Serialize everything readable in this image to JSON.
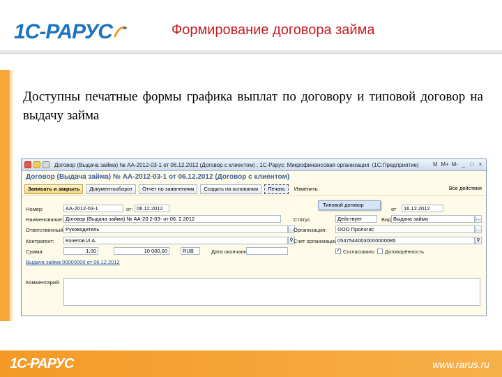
{
  "slide": {
    "logo": "1С-РАРУС",
    "title": "Формирование договора займа",
    "body": "Доступны печатные формы графика выплат по договору и типовой договор на выдачу займа",
    "footer_logo": "1С-РАРУС",
    "footer_url": "www.rarus.ru"
  },
  "window": {
    "title": "Договор (Выдача займа) № АА-2012-03-1 от 06.12.2012 (Договор с клиентом) : 1С-Рарус: Микрофинансовая организация",
    "title_suffix": "(1С:Предприятие)",
    "controls": [
      "M",
      "M+",
      "M-",
      "_",
      "□",
      "×"
    ],
    "doc_header": "Договор (Выдача займа) № АА-2012-03-1 от 06.12.2012 (Договор с клиентом)",
    "toolbar": {
      "save_close": "Записать и закрыть",
      "docflow": "Документооборот",
      "report": "Отчет по заявлениям",
      "create_basis": "Создать на основании",
      "print": "Печать",
      "change": "Изменить",
      "all_actions": "Все действия"
    },
    "dropdown": {
      "item": "Типовой договор"
    },
    "fields": {
      "number_label": "Номер:",
      "number_value": "АА-2012-03-1",
      "from_label": "от:",
      "from_value": "06.12.2012",
      "name_label": "Наименование:",
      "name_value": "Договор (Выдача займа) № АА-20 2-03- от 06. 2.2012",
      "author_label": "Ответственный:",
      "author_value": "Руководитель",
      "contractor_label": "Контрагент:",
      "contractor_value": "Кочетов И.А.",
      "amount_label": "Сумма:",
      "qty_value": "1,00",
      "amount_value": "10 000,00",
      "currency_value": "RUB",
      "due_label": "Дата окончания:",
      "link_text": "Выдача займа 00000000 от 06.12.2012",
      "status_label": "Статус",
      "status_value": "Действует",
      "kind_label": "Вид:",
      "kind_value": "Выдача займа",
      "date_from_label": "от",
      "date_from_value": "16.12.2012",
      "org_label": "Организация:",
      "org_value": "ООО Прологис",
      "org_rep_label": "Счет организации:",
      "org_rep_value": "05475440030000000085",
      "agreed_label": "Согласовано",
      "contracted_label": "Договорённость",
      "comment_label": "Комментарий:"
    }
  }
}
